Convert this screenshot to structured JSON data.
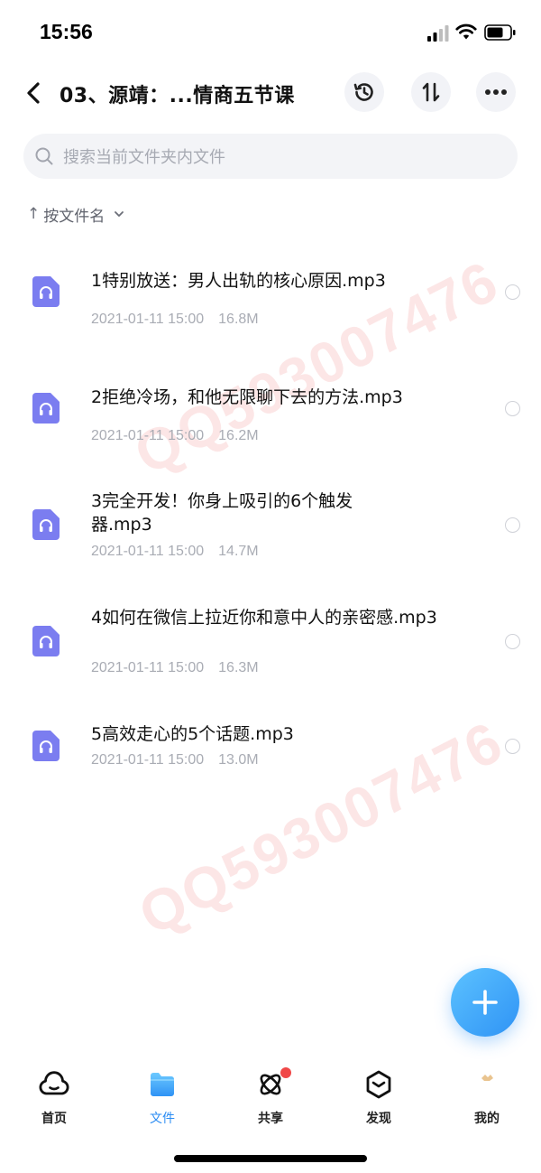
{
  "status_bar": {
    "time": "15:56"
  },
  "header": {
    "title": "03、源靖：...情商五节课"
  },
  "search": {
    "placeholder": "搜索当前文件夹内文件"
  },
  "sort": {
    "arrow": "↑",
    "label": "按文件名"
  },
  "files": [
    {
      "name": "1特别放送：男人出轨的核心原因.mp3",
      "date": "2021-01-11 15:00",
      "size": "16.8M"
    },
    {
      "name": "2拒绝冷场，和他无限聊下去的方法.mp3",
      "date": "2021-01-11 15:00",
      "size": "16.2M"
    },
    {
      "name": "3完全开发！你身上吸引的6个触发器.mp3",
      "date": "2021-01-11 15:00",
      "size": "14.7M"
    },
    {
      "name": "4如何在微信上拉近你和意中人的亲密感.mp3",
      "date": "2021-01-11 15:00",
      "size": "16.3M"
    },
    {
      "name": "5高效走心的5个话题.mp3",
      "date": "2021-01-11 15:00",
      "size": "13.0M"
    }
  ],
  "watermarks": [
    "QQ593007476",
    "QQ593007476"
  ],
  "tab_bar": {
    "tabs": [
      {
        "label": "首页",
        "icon": "home-cloud-icon"
      },
      {
        "label": "文件",
        "icon": "folder-icon",
        "active": true
      },
      {
        "label": "共享",
        "icon": "atom-share-icon",
        "badge": true
      },
      {
        "label": "发现",
        "icon": "discover-hexagon-icon"
      },
      {
        "label": "我的",
        "icon": "profile-avatar-icon"
      }
    ]
  },
  "colors": {
    "accent": "#2b8cf3",
    "file_icon": "#7b7df0",
    "badge": "#f04848"
  }
}
